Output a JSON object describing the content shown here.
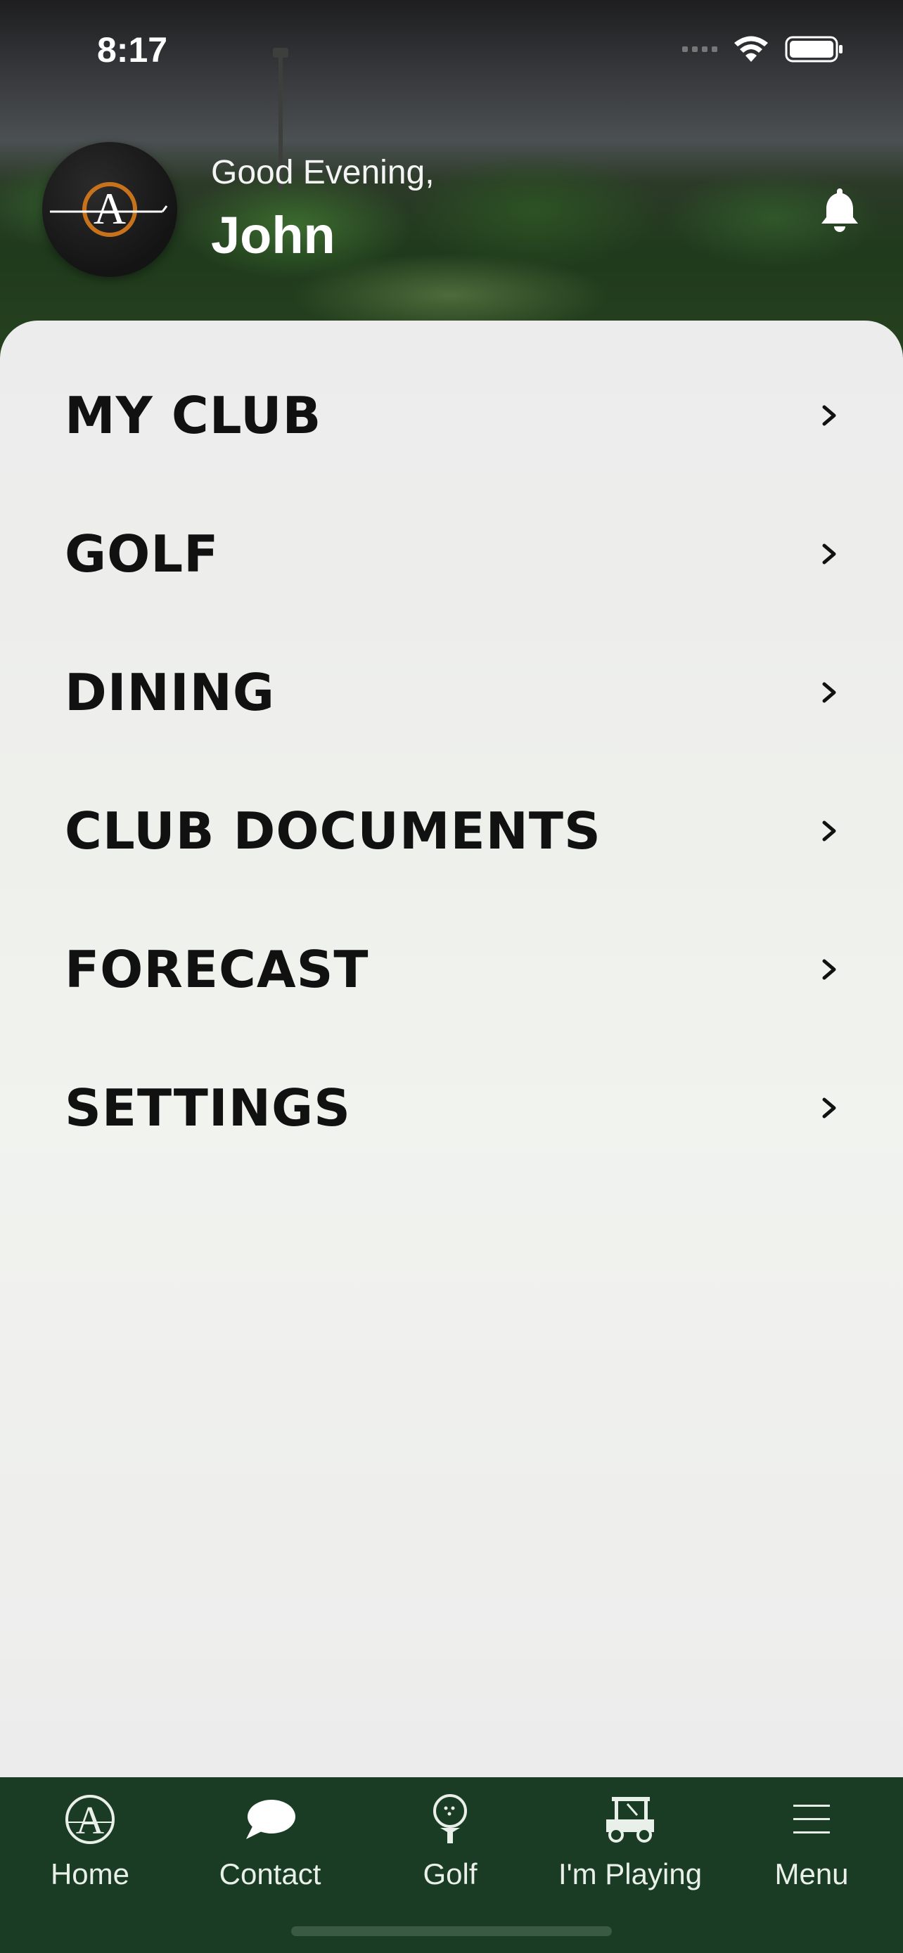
{
  "status_bar": {
    "time": "8:17"
  },
  "header": {
    "greeting": "Good Evening,",
    "name": "John",
    "logo_letter": "A"
  },
  "menu": {
    "items": [
      {
        "label": "MY CLUB"
      },
      {
        "label": "GOLF"
      },
      {
        "label": "DINING"
      },
      {
        "label": "CLUB DOCUMENTS"
      },
      {
        "label": "FORECAST"
      },
      {
        "label": "SETTINGS"
      }
    ]
  },
  "tabbar": {
    "tabs": [
      {
        "label": "Home",
        "icon": "club-logo-icon"
      },
      {
        "label": "Contact",
        "icon": "chat-bubble-icon"
      },
      {
        "label": "Golf",
        "icon": "golf-ball-tee-icon"
      },
      {
        "label": "I'm Playing",
        "icon": "golf-cart-icon"
      },
      {
        "label": "Menu",
        "icon": "hamburger-menu-icon"
      }
    ]
  },
  "colors": {
    "tabbar_bg": "#1b3c24",
    "logo_accent": "#c8731c"
  }
}
